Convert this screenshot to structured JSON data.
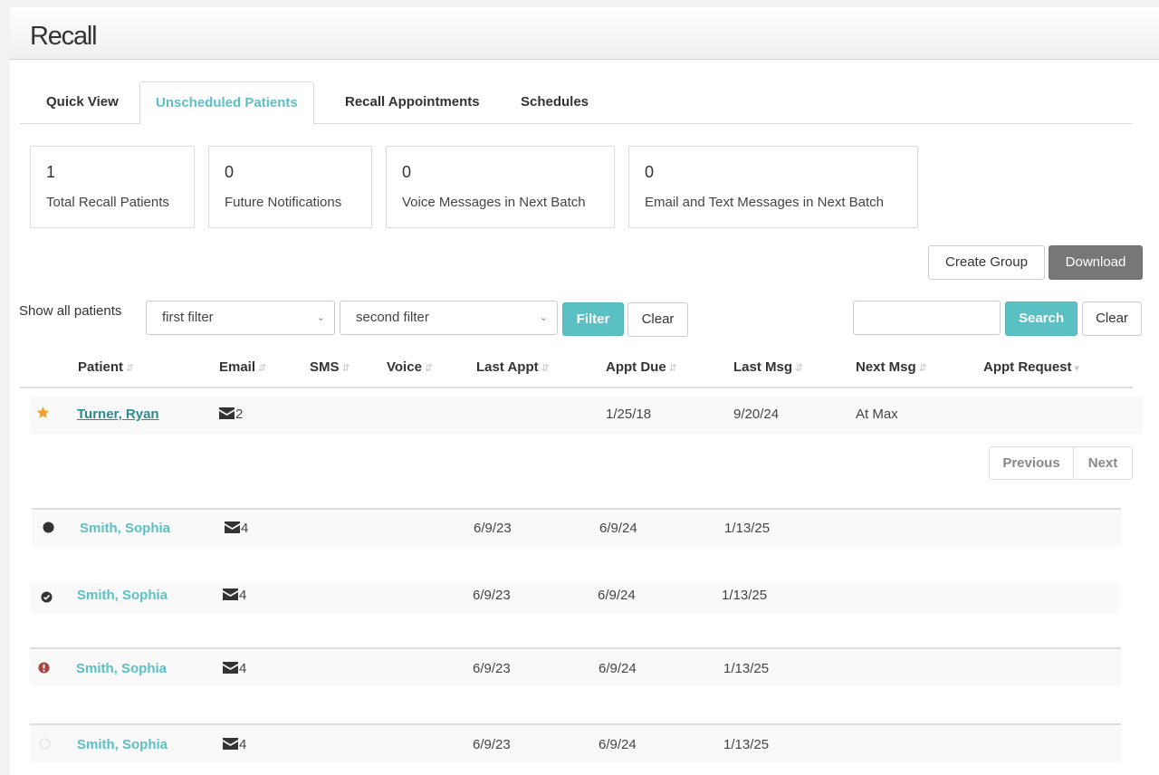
{
  "header": {
    "title": "Recall"
  },
  "tabs": [
    {
      "label": "Quick View",
      "active": false
    },
    {
      "label": "Unscheduled Patients",
      "active": true
    },
    {
      "label": "Recall Appointments",
      "active": false
    },
    {
      "label": "Schedules",
      "active": false
    }
  ],
  "stats": [
    {
      "value": "1",
      "label": "Total Recall Patients"
    },
    {
      "value": "0",
      "label": "Future Notifications"
    },
    {
      "value": "0",
      "label": "Voice Messages in Next Batch"
    },
    {
      "value": "0",
      "label": "Email and Text Messages in Next Batch"
    }
  ],
  "actions": {
    "create_group": "Create Group",
    "download": "Download"
  },
  "filters": {
    "show_label": "Show all patients",
    "first_filter": "first filter",
    "second_filter": "second filter",
    "filter_button": "Filter",
    "clear_button": "Clear"
  },
  "search": {
    "value": "",
    "placeholder": "",
    "search_button": "Search",
    "clear_button": "Clear"
  },
  "table": {
    "columns": [
      "Patient",
      "Email",
      "SMS",
      "Voice",
      "Last Appt",
      "Appt Due",
      "Last Msg",
      "Next Msg",
      "Appt Request"
    ],
    "rows": [
      {
        "status_icon": "star-icon",
        "patient": "Turner, Ryan",
        "email": "2",
        "sms": "",
        "voice": "",
        "last_appt": "",
        "appt_due": "1/25/18",
        "last_msg": "9/20/24",
        "next_msg": "At Max",
        "appt_request": ""
      }
    ]
  },
  "pagination": {
    "previous": "Previous",
    "next": "Next"
  },
  "examples": [
    {
      "status_icon": "filled-circle-icon",
      "patient": "Smith, Sophia",
      "email": "4",
      "last_appt": "6/9/23",
      "appt_due": "6/9/24",
      "last_msg": "1/13/25"
    },
    {
      "status_icon": "check-circle-icon",
      "patient": "Smith, Sophia",
      "email": "4",
      "last_appt": "6/9/23",
      "appt_due": "6/9/24",
      "last_msg": "1/13/25"
    },
    {
      "status_icon": "exclamation-circle-icon",
      "patient": "Smith, Sophia",
      "email": "4",
      "last_appt": "6/9/23",
      "appt_due": "6/9/24",
      "last_msg": "1/13/25"
    },
    {
      "status_icon": "empty-circle-icon",
      "patient": "Smith, Sophia",
      "email": "4",
      "last_appt": "6/9/23",
      "appt_due": "6/9/24",
      "last_msg": "1/13/25"
    }
  ],
  "colors": {
    "accent": "#5bc0c4",
    "link": "#2c8b8f",
    "star": "#f0a030",
    "error": "#a94442",
    "download_bg": "#777777"
  }
}
